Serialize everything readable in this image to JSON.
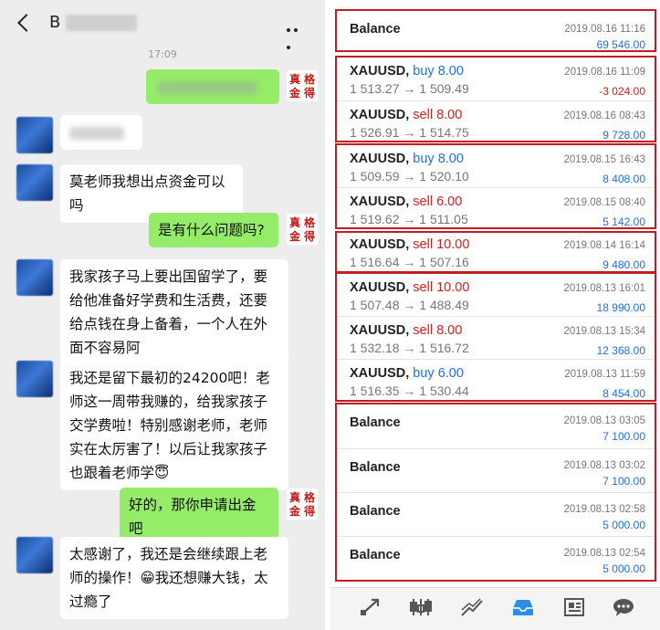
{
  "chat": {
    "title": "B",
    "time": "17:09",
    "avatar_text": [
      "真",
      "格",
      "金",
      "得"
    ],
    "messages": [
      {
        "side": "out",
        "text": "",
        "blurred": true
      },
      {
        "side": "in",
        "text": "",
        "blurred": true
      },
      {
        "side": "in",
        "text": "莫老师我想出点资金可以吗"
      },
      {
        "side": "out",
        "text": "是有什么问题吗?"
      },
      {
        "side": "in",
        "text": "我家孩子马上要出国留学了，要给他准备好学费和生活费，还要给点钱在身上备着，一个人在外面不容易阿"
      },
      {
        "side": "in",
        "text": "我还是留下最初的24200吧！老师这一周带我赚的，给我家孩子交学费啦！特别感谢老师，老师实在太厉害了！以后让我家孩子也跟着老师学😇"
      },
      {
        "side": "out",
        "text": "好的，那你申请出金吧"
      },
      {
        "side": "in",
        "text": "太感谢了，我还是会继续跟上老师的操作！😁我还想赚大钱，太过瘾了"
      }
    ]
  },
  "history": {
    "rows": [
      {
        "type": "balance",
        "label": "Balance",
        "date": "2019.08.16 11:16",
        "amount": "69 546.00",
        "sign": "pos"
      },
      {
        "type": "trade",
        "symbol": "XAUUSD,",
        "dir": "buy",
        "lots": "8.00",
        "prices": "1 513.27 → 1 509.49",
        "date": "2019.08.16 11:09",
        "amount": "-3 024.00",
        "sign": "neg"
      },
      {
        "type": "trade",
        "symbol": "XAUUSD,",
        "dir": "sell",
        "lots": "8.00",
        "prices": "1 526.91 → 1 514.75",
        "date": "2019.08.16 08:43",
        "amount": "9 728.00",
        "sign": "pos"
      },
      {
        "type": "trade",
        "symbol": "XAUUSD,",
        "dir": "buy",
        "lots": "8.00",
        "prices": "1 509.59 → 1 520.10",
        "date": "2019.08.15 16:43",
        "amount": "8 408.00",
        "sign": "pos"
      },
      {
        "type": "trade",
        "symbol": "XAUUSD,",
        "dir": "sell",
        "lots": "6.00",
        "prices": "1 519.62 → 1 511.05",
        "date": "2019.08.15 08:40",
        "amount": "5 142.00",
        "sign": "pos"
      },
      {
        "type": "trade",
        "symbol": "XAUUSD,",
        "dir": "sell",
        "lots": "10.00",
        "prices": "1 516.64 → 1 507.16",
        "date": "2019.08.14 16:14",
        "amount": "9 480.00",
        "sign": "pos"
      },
      {
        "type": "trade",
        "symbol": "XAUUSD,",
        "dir": "sell",
        "lots": "10.00",
        "prices": "1 507.48 → 1 488.49",
        "date": "2019.08.13 16:01",
        "amount": "18 990.00",
        "sign": "pos"
      },
      {
        "type": "trade",
        "symbol": "XAUUSD,",
        "dir": "sell",
        "lots": "8.00",
        "prices": "1 532.18 → 1 516.72",
        "date": "2019.08.13 15:34",
        "amount": "12 368.00",
        "sign": "pos"
      },
      {
        "type": "trade",
        "symbol": "XAUUSD,",
        "dir": "buy",
        "lots": "6.00",
        "prices": "1 516.35 → 1 530.44",
        "date": "2019.08.13 11:59",
        "amount": "8 454.00",
        "sign": "pos"
      },
      {
        "type": "balance",
        "label": "Balance",
        "date": "2019.08.13 03:05",
        "amount": "7 100.00",
        "sign": "pos"
      },
      {
        "type": "balance",
        "label": "Balance",
        "date": "2019.08.13 03:02",
        "amount": "7 100.00",
        "sign": "pos"
      },
      {
        "type": "balance",
        "label": "Balance",
        "date": "2019.08.13 02:58",
        "amount": "5 000.00",
        "sign": "pos"
      },
      {
        "type": "balance",
        "label": "Balance",
        "date": "2019.08.13 02:54",
        "amount": "5 000.00",
        "sign": "pos"
      }
    ],
    "nav_icons": [
      "trade-icon",
      "chart-icon",
      "quotes-icon",
      "history-icon",
      "news-icon",
      "chat-icon"
    ],
    "colors": {
      "frame": "#c21c25",
      "buy": "#2070d8",
      "sell": "#d61e1e",
      "bubble_out": "#95ec69"
    }
  }
}
